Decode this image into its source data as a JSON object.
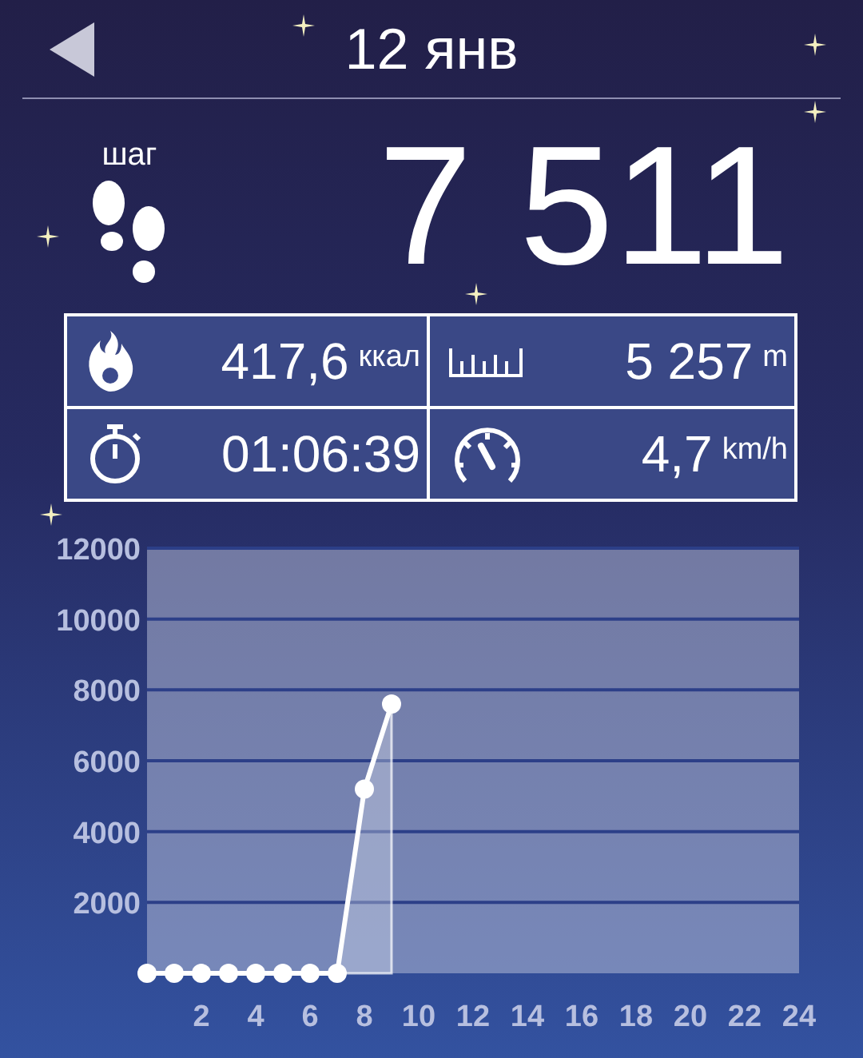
{
  "header": {
    "title": "12 янв"
  },
  "steps": {
    "label": "шаг",
    "value": "7 511"
  },
  "stats": [
    {
      "kind": "calories",
      "value": "417,6",
      "unit": "ккал"
    },
    {
      "kind": "distance",
      "value": "5 257",
      "unit": "m"
    },
    {
      "kind": "duration",
      "value": "01:06:39"
    },
    {
      "kind": "speed",
      "value": "4,7",
      "unit": "km/h"
    }
  ],
  "chart": {
    "chart_data": {
      "type": "line",
      "x": [
        0,
        1,
        2,
        3,
        4,
        5,
        6,
        7,
        8,
        9
      ],
      "series": [
        {
          "color": "#ffffff",
          "marker": "circle",
          "values": [
            0,
            0,
            0,
            0,
            0,
            0,
            0,
            0,
            5200,
            7600
          ]
        }
      ],
      "xlim": [
        0,
        24
      ],
      "ylim": [
        0,
        12000
      ],
      "xticks": [
        2,
        4,
        6,
        8,
        10,
        12,
        14,
        16,
        18,
        20,
        22,
        24
      ],
      "yticks": [
        2000,
        4000,
        6000,
        8000,
        10000,
        12000
      ],
      "grid": true
    }
  }
}
